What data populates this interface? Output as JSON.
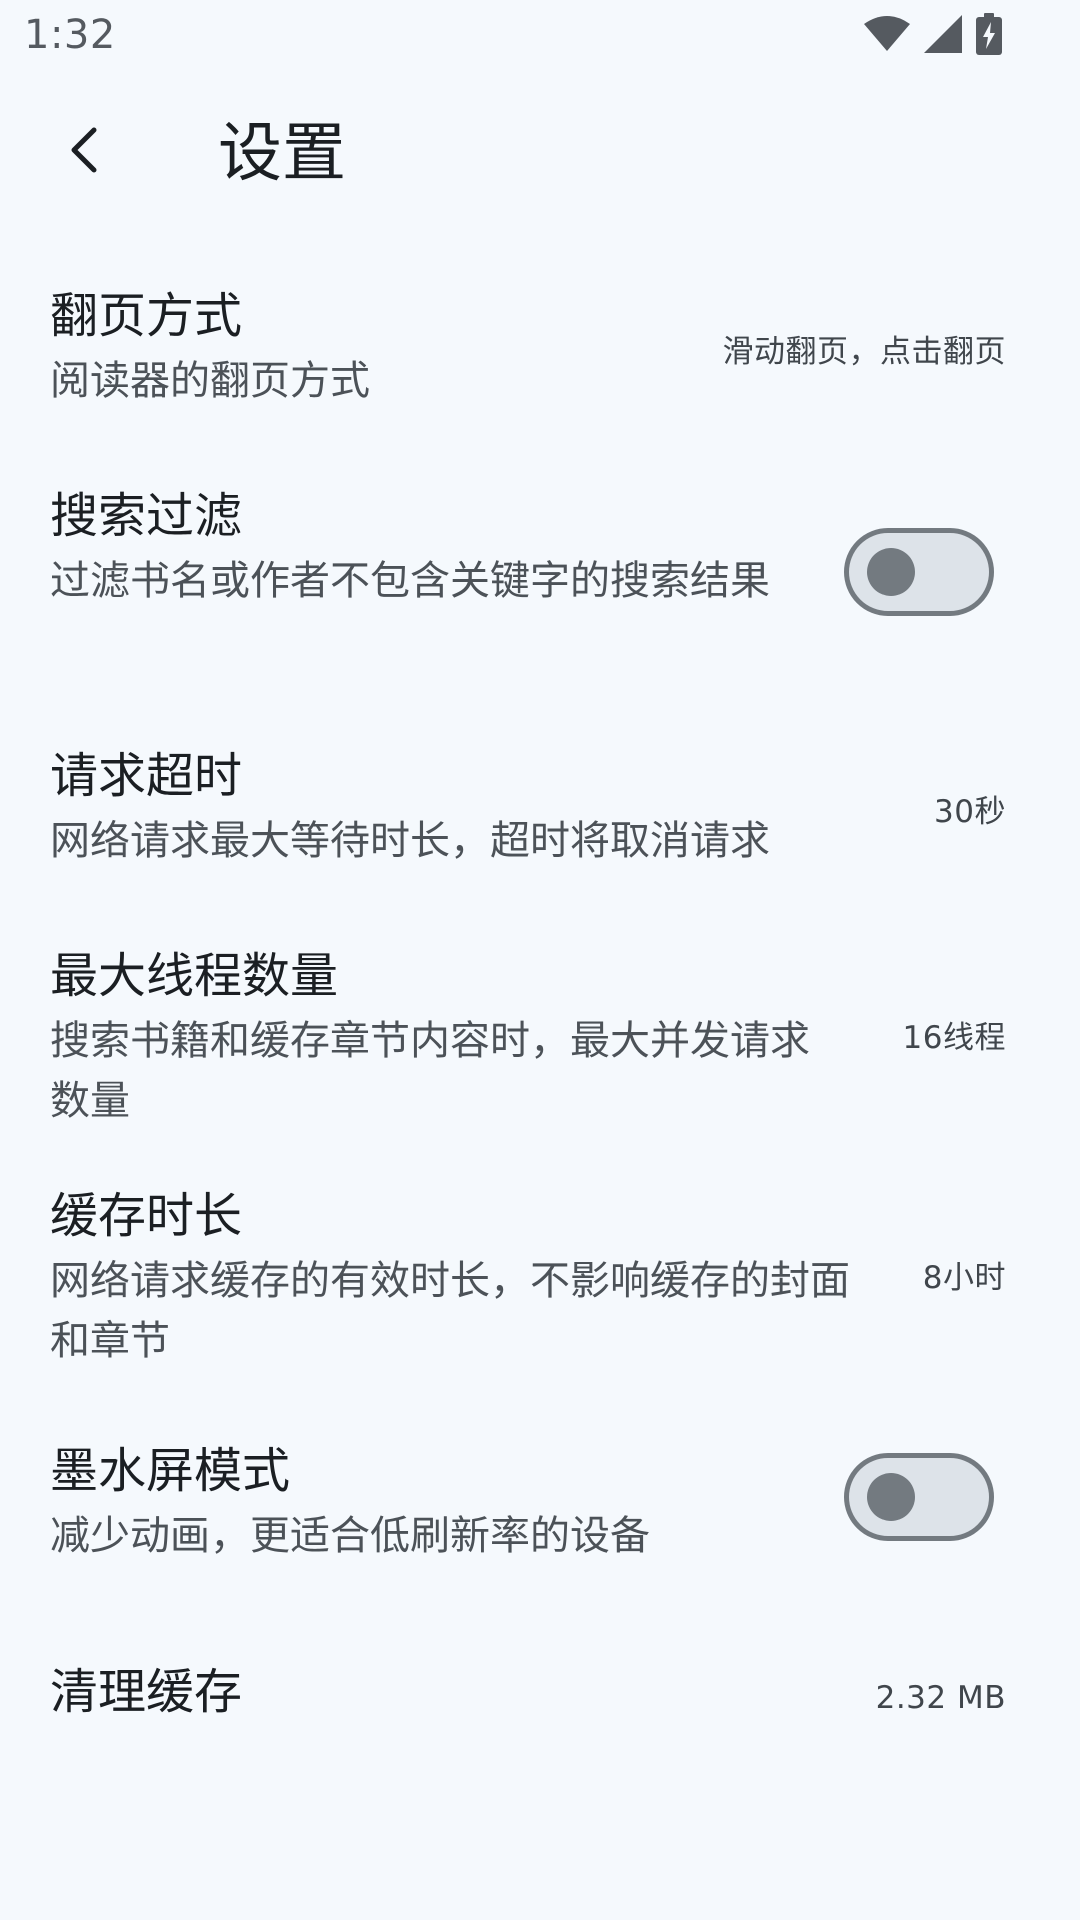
{
  "status_bar": {
    "time": "1:32",
    "icons": [
      "wifi-icon",
      "cell-signal-icon",
      "battery-charging-icon"
    ]
  },
  "top_bar": {
    "back_icon": "back-arrow-icon",
    "title": "设置"
  },
  "settings": [
    {
      "title": "翻页方式",
      "desc": "阅读器的翻页方式",
      "value": "滑动翻页，点击翻页",
      "control": "value"
    },
    {
      "title": "搜索过滤",
      "desc": "过滤书名或作者不包含关键字的搜索结果",
      "enabled": false,
      "control": "switch"
    },
    {
      "title": "请求超时",
      "desc": "网络请求最大等待时长，超时将取消请求",
      "value": "30秒",
      "control": "value"
    },
    {
      "title": "最大线程数量",
      "desc": "搜索书籍和缓存章节内容时，最大并发请求数量",
      "value": "16线程",
      "control": "value"
    },
    {
      "title": "缓存时长",
      "desc": "网络请求缓存的有效时长，不影响缓存的封面和章节",
      "value": "8小时",
      "control": "value"
    },
    {
      "title": "墨水屏模式",
      "desc": "减少动画，更适合低刷新率的设备",
      "enabled": false,
      "control": "switch"
    },
    {
      "title": "清理缓存",
      "value": "2.32 MB",
      "control": "value"
    }
  ],
  "colors": {
    "background": "#f5f9fd",
    "text_primary": "#1b1f23",
    "text_secondary": "#4c5258",
    "switch_outline": "#737a80",
    "switch_track": "#dde3e9"
  }
}
